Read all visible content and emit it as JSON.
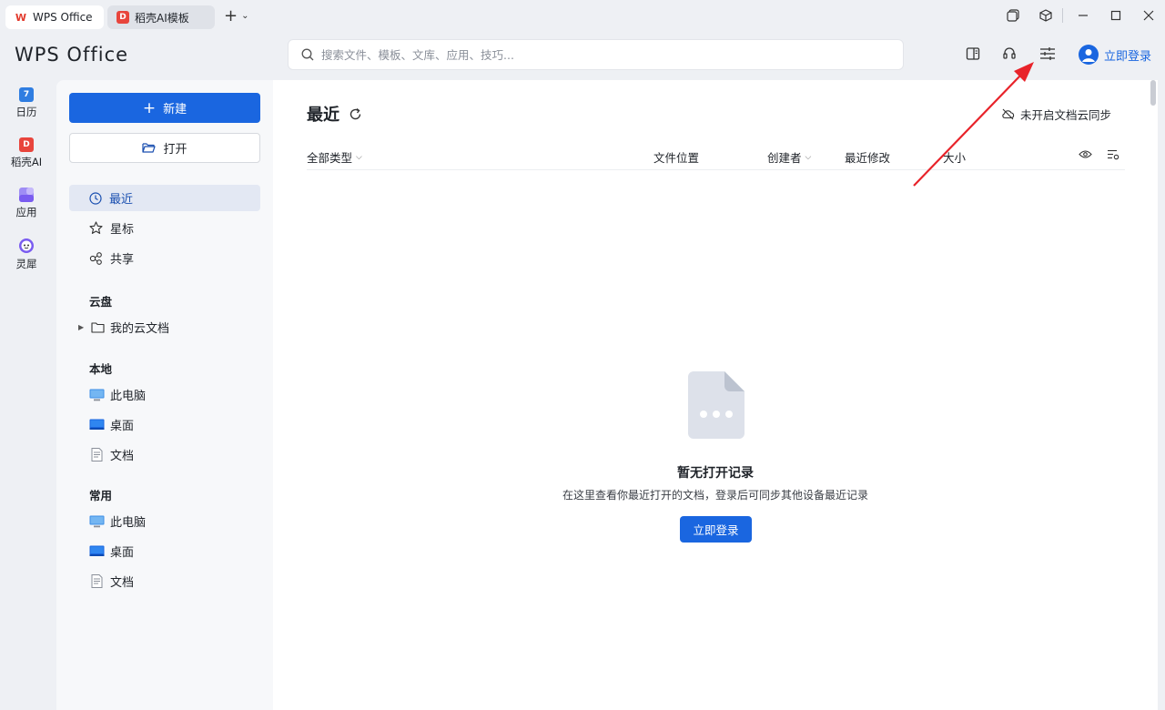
{
  "tabs": [
    {
      "label": "WPS Office",
      "logo": "W"
    },
    {
      "label": "稻壳AI模板",
      "logo": "D"
    }
  ],
  "brand": "WPS Office",
  "search": {
    "placeholder": "搜索文件、模板、文库、应用、技巧..."
  },
  "header": {
    "login_label": "立即登录"
  },
  "rail": [
    {
      "label": "日历",
      "badge": "7",
      "color": "#2f7de1"
    },
    {
      "label": "稻壳AI",
      "badge": "D",
      "color": "#e8453c"
    },
    {
      "label": "应用",
      "badge": "",
      "color": "#7a5cf0"
    },
    {
      "label": "灵犀",
      "badge": "",
      "color": "#7a5cf0"
    }
  ],
  "sidebar": {
    "new_label": "新建",
    "open_label": "打开",
    "nav": [
      {
        "label": "最近"
      },
      {
        "label": "星标"
      },
      {
        "label": "共享"
      }
    ],
    "cloud": {
      "title": "云盘",
      "items": [
        {
          "label": "我的云文档"
        }
      ]
    },
    "local": {
      "title": "本地",
      "items": [
        {
          "label": "此电脑"
        },
        {
          "label": "桌面"
        },
        {
          "label": "文档"
        }
      ]
    },
    "common": {
      "title": "常用",
      "items": [
        {
          "label": "此电脑"
        },
        {
          "label": "桌面"
        },
        {
          "label": "文档"
        }
      ]
    }
  },
  "main": {
    "title": "最近",
    "sync_label": "未开启文档云同步",
    "columns": {
      "type": "全部类型",
      "location": "文件位置",
      "creator": "创建者",
      "modified": "最近修改",
      "size": "大小"
    },
    "empty": {
      "title": "暂无打开记录",
      "desc": "在这里查看你最近打开的文档，登录后可同步其他设备最近记录",
      "login_label": "立即登录"
    }
  },
  "colors": {
    "accent": "#1a66e0",
    "arrow": "#e8232a"
  }
}
